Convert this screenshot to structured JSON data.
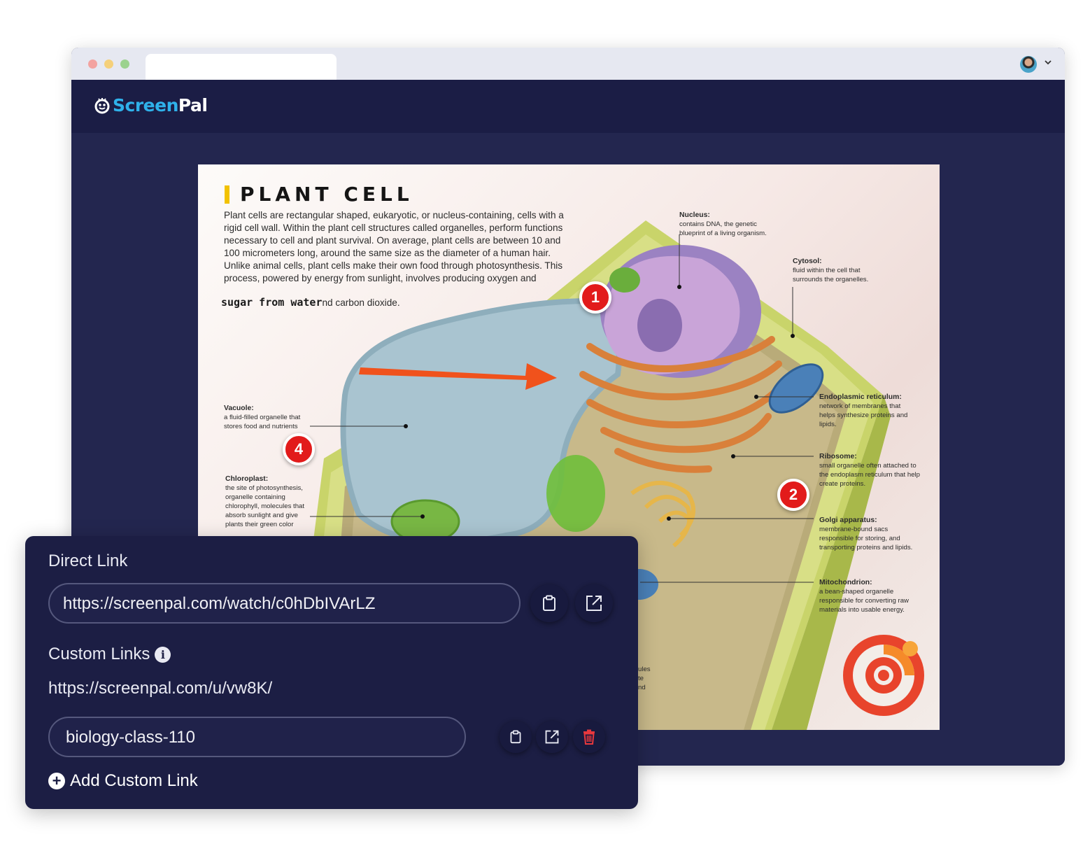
{
  "brand": {
    "name_part1": "Screen",
    "name_part2": "Pal",
    "accent_color": "#2fb1ea",
    "header_bg": "#1b1d45",
    "content_bg": "#23264f"
  },
  "poster": {
    "title": "PLANT CELL",
    "description": "Plant cells are rectangular shaped, eukaryotic, or nucleus-containing, cells with a rigid cell wall. Within the plant cell structures called organelles, perform functions necessary to cell and plant survival. On average, plant cells are between 10 and 100 micrometers long, around the same size as the diameter of a human hair. Unlike animal cells, plant cells make their own food through photosynthesis. This process, powered by energy from sunlight, involves producing oxygen and",
    "description_overlay": "sugar from water",
    "description_tail": "nd carbon dioxide.",
    "labels": {
      "nucleus_title": "Nucleus:",
      "nucleus_text": "contains DNA, the genetic blueprint of a living organism.",
      "cytosol_title": "Cytosol:",
      "cytosol_text": "fluid within the cell that surrounds the organelles.",
      "er_title": "Endoplasmic reticulum:",
      "er_text": "network of membranes that helps synthesize proteins and lipids.",
      "ribosome_title": "Ribosome:",
      "ribosome_text": "small organelle often attached to the endoplasm reticulum that help create proteins.",
      "golgi_title": "Golgi apparatus:",
      "golgi_text": "membrane-bound sacs responsible for storing, and transporting proteins and lipids.",
      "mito_title": "Mitochondrion:",
      "mito_text": "a bean-shaped organelle responsible for converting raw materials into usable energy.",
      "vacuole_title": "Vacuole:",
      "vacuole_text": "a fluid-filled organelle that stores food and nutrients",
      "chloro_title": "Chloroplast:",
      "chloro_text": "the site of photosynthesis, organelle containing chlorophyll, molecules that absorb sunlight and give plants their green color",
      "partial_text": "ules te nd"
    },
    "markers": [
      "1",
      "2",
      "4"
    ]
  },
  "share": {
    "direct_link_label": "Direct Link",
    "direct_link_url": "https://screenpal.com/watch/c0hDbIVArLZ",
    "custom_links_label": "Custom Links",
    "custom_base_url": "https://screenpal.com/u/vw8K/",
    "custom_slug": "biology-class-110",
    "add_custom_link": "Add Custom Link",
    "delete_color": "#e8383d"
  }
}
